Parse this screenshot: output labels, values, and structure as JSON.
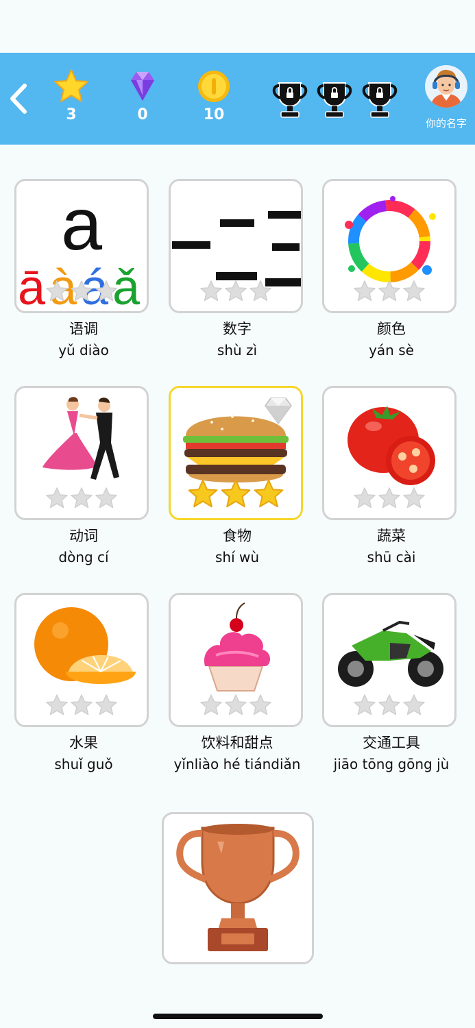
{
  "colors": {
    "header_bg": "#53b7f0",
    "card_border": "#d2d2d2",
    "active_border": "#f6d62a",
    "star_gold": "#f7c81d",
    "star_empty": "#dddddd"
  },
  "header": {
    "stars_count": "3",
    "diamonds_count": "0",
    "coins_count": "10",
    "username": "你的名字",
    "icons": [
      "back-chevron-icon",
      "star-icon",
      "diamond-icon",
      "coin-icon",
      "locked-trophy-icon",
      "avatar"
    ]
  },
  "lessons": [
    {
      "zh": "语调",
      "pinyin": "yǔ diào",
      "stars_earned": 0,
      "icon": "tone-icon",
      "tone_letters": [
        "a",
        "ā",
        "à",
        "á",
        "ǎ"
      ]
    },
    {
      "zh": "数字",
      "pinyin": "shù zì",
      "stars_earned": 0,
      "icon": "numbers-icon"
    },
    {
      "zh": "颜色",
      "pinyin": "yán sè",
      "stars_earned": 0,
      "icon": "paint-splash-icon"
    },
    {
      "zh": "动词",
      "pinyin": "dòng cí",
      "stars_earned": 0,
      "icon": "dancers-icon"
    },
    {
      "zh": "食物",
      "pinyin": "shí wù",
      "stars_earned": 3,
      "icon": "burger-icon",
      "active": true,
      "diamond_badge": true
    },
    {
      "zh": "蔬菜",
      "pinyin": "shū cài",
      "stars_earned": 0,
      "icon": "tomato-icon"
    },
    {
      "zh": "水果",
      "pinyin": "shuǐ guǒ",
      "stars_earned": 0,
      "icon": "orange-icon"
    },
    {
      "zh": "饮料和甜点",
      "pinyin": "yǐnliào hé tiándiǎn",
      "stars_earned": 0,
      "icon": "cupcake-icon"
    },
    {
      "zh": "交通工具",
      "pinyin": "jiāo tōng gōng jù",
      "stars_earned": 0,
      "icon": "motorcycle-icon"
    }
  ],
  "final_reward": {
    "icon": "bronze-trophy-icon"
  }
}
